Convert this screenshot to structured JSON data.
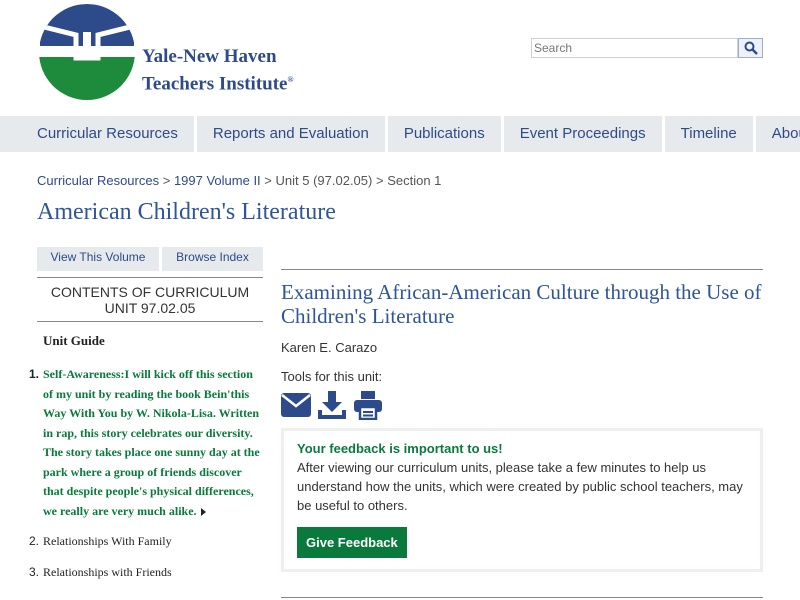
{
  "logo": {
    "line1": "Yale-New Haven",
    "line2": "Teachers Institute",
    "mark": "®",
    "colors": {
      "blue": "#2d4a8a",
      "green": "#1e8a3c"
    }
  },
  "search": {
    "placeholder": "Search",
    "icon": "search-icon"
  },
  "nav": [
    "Curricular Resources",
    "Reports and Evaluation",
    "Publications",
    "Event Proceedings",
    "Timeline",
    "About the Institute"
  ],
  "breadcrumb": {
    "items": [
      "Curricular Resources",
      "1997 Volume II",
      "Unit 5 (97.02.05)",
      "Section 1"
    ],
    "separator": ">"
  },
  "page_title": "American Children's Literature",
  "left": {
    "view_volume": "View This Volume",
    "browse_index": "Browse Index",
    "contents_line1": "CONTENTS OF CURRICULUM",
    "contents_line2": "UNIT 97.02.05",
    "unit_guide": "Unit Guide",
    "items": [
      {
        "num": "1.",
        "text": "Self-Awareness:I will kick off this section of my unit by reading the book Bein'this Way With You by W. Nikola-Lisa. Written in rap, this story celebrates our diversity. The story takes place one sunny day at the park where a group of friends discover that despite people's physical differences, we really are very much alike."
      },
      {
        "num": "2.",
        "text": "Relationships With Family"
      },
      {
        "num": "3.",
        "text": "Relationships with Friends"
      }
    ]
  },
  "unit": {
    "title": "Examining African-American Culture through the Use of Children's Literature",
    "author": "Karen E. Carazo",
    "tools_label": "Tools for this unit:",
    "tools": [
      "envelope-icon",
      "download-icon",
      "print-icon"
    ]
  },
  "feedback": {
    "heading": "Your feedback is important to us!",
    "body": "After viewing our curriculum units, please take a few minutes to help us understand how the units, which were created by public school teachers, may be useful to others.",
    "button": "Give Feedback"
  },
  "colors": {
    "link": "#2d4a8a",
    "title": "#2d5597",
    "green": "#0a7a3c",
    "nav_bg": "#e7eaec"
  }
}
